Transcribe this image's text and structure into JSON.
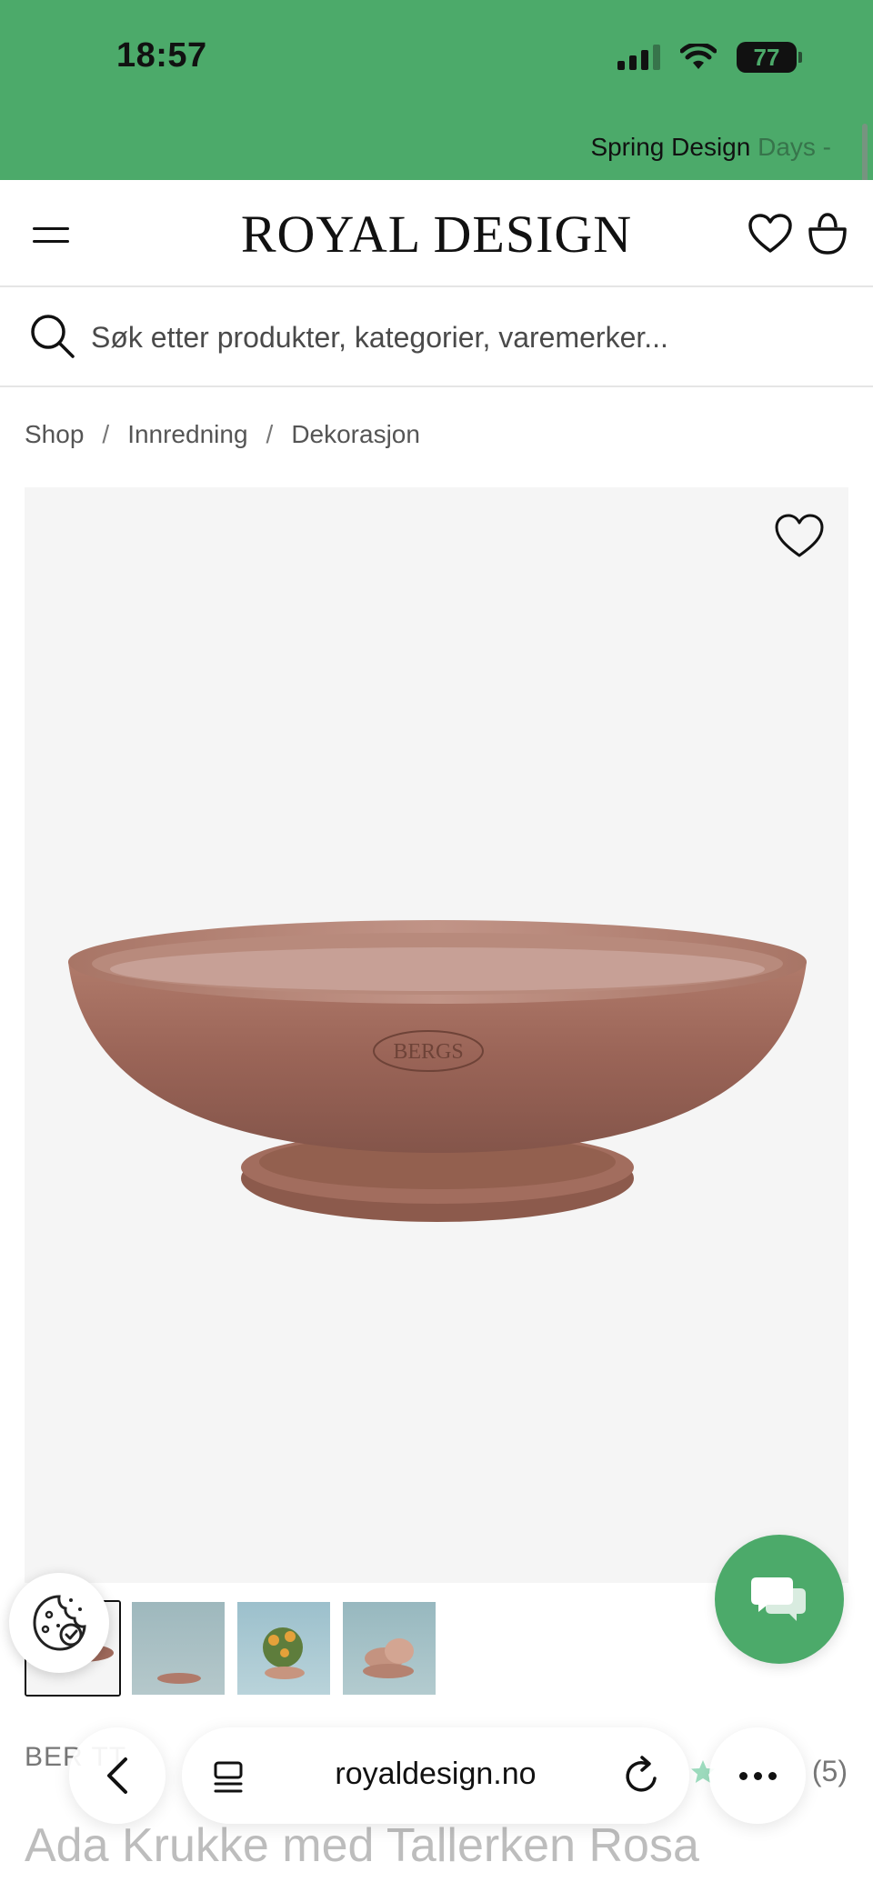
{
  "status_bar": {
    "time": "18:57",
    "battery": "77",
    "icons": [
      "signal-icon",
      "wifi-icon",
      "battery-icon"
    ]
  },
  "promo": {
    "text": "Spring Design",
    "fade_text": "Days -"
  },
  "header": {
    "logo": "ROYAL DESIGN",
    "icons": [
      "menu-icon",
      "heart-icon",
      "bag-icon"
    ]
  },
  "search": {
    "placeholder": "Søk etter produkter, kategorier, varemerker..."
  },
  "breadcrumb": {
    "items": [
      "Shop",
      "Innredning",
      "Dekorasjon"
    ],
    "separator": "/"
  },
  "product": {
    "image_stamp": "BERGS",
    "brand": "BERGS POTTER",
    "brand_visible": "BER   TT",
    "rating_count": "(5)",
    "title": "Ada Krukke med Tallerken Rosa"
  },
  "browser": {
    "url": "royaldesign.no"
  },
  "colors": {
    "brand_green": "#4caa6a",
    "image_bg": "#f5f5f5",
    "terracotta": "#a06a5c"
  }
}
